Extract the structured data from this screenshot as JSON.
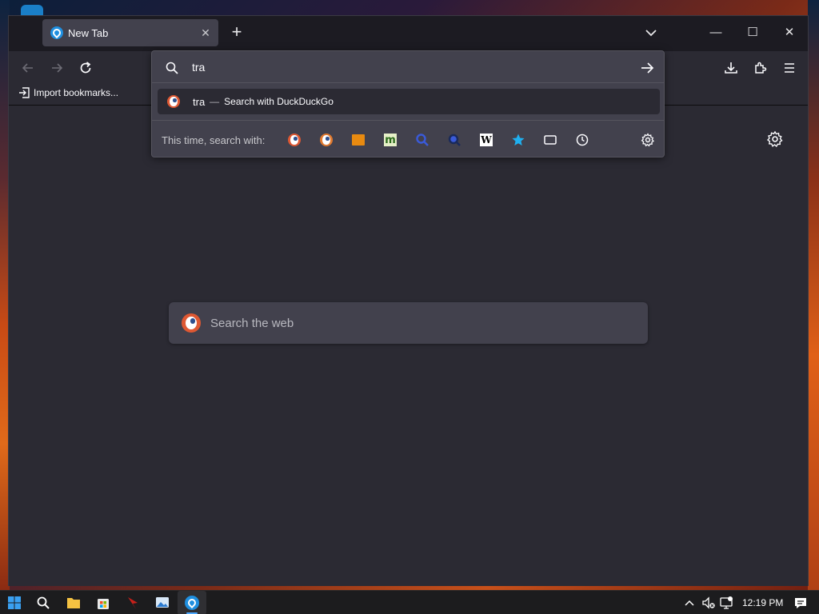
{
  "browser": {
    "tab_title": "New Tab",
    "new_tab_label": "+",
    "tab_close_label": "✕",
    "window_controls": {
      "minimize": "—",
      "maximize": "☐",
      "close": "✕"
    }
  },
  "bookmarks": {
    "import_label": "Import bookmarks..."
  },
  "urlbar": {
    "value": "tra",
    "result": {
      "query": "tra",
      "separator": "—",
      "action": "Search with DuckDuckGo"
    },
    "one_off_label": "This time, search with:",
    "engines": [
      {
        "name": "duckduckgo-icon"
      },
      {
        "name": "duckduckgo-alt-icon"
      },
      {
        "name": "mdn-icon"
      },
      {
        "name": "m-engine-icon"
      },
      {
        "name": "search-engine-magnifier-icon"
      },
      {
        "name": "search-engine-dark-icon"
      },
      {
        "name": "wikipedia-icon"
      },
      {
        "name": "bookmarks-star-icon"
      },
      {
        "name": "tabs-icon"
      },
      {
        "name": "history-icon"
      },
      {
        "name": "search-settings-icon"
      }
    ]
  },
  "newtab": {
    "search_placeholder": "Search the web"
  },
  "taskbar": {
    "clock": "12:19 PM"
  },
  "colors": {
    "accent": "#4aa8ff",
    "ddg": "#de5833",
    "panel": "#42414d",
    "background": "#2b2a33"
  }
}
